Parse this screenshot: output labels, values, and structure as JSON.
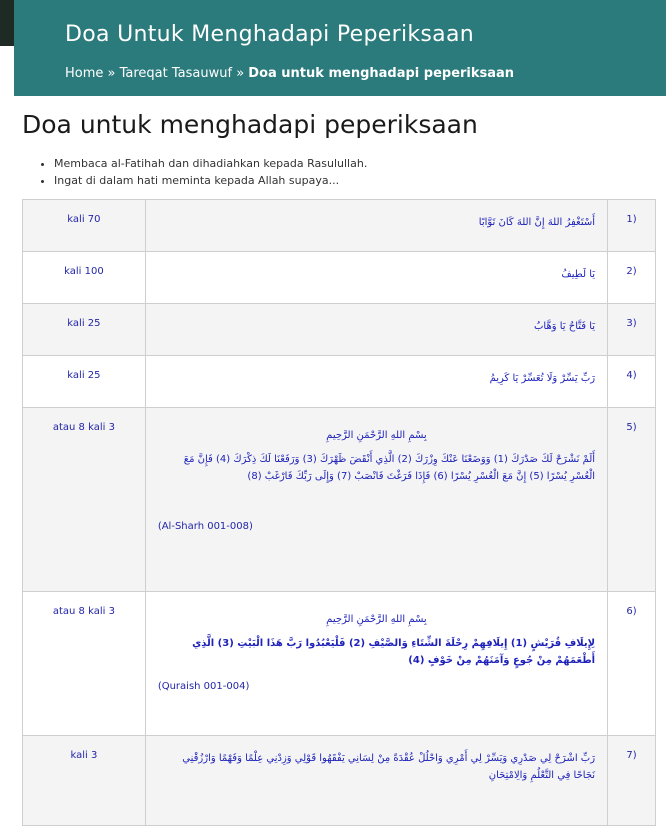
{
  "header": {
    "title": "Doa Untuk Menghadapi Peperiksaan",
    "breadcrumb": {
      "home": "Home",
      "sep1": " » ",
      "category": "Tareqat Tasauwuf",
      "sep2": " » ",
      "current": "Doa untuk menghadapi peperiksaan"
    }
  },
  "page_title": "Doa untuk menghadapi peperiksaan",
  "bullets": [
    "Membaca al-Fatihah dan dihadiahkan kepada Rasulullah.",
    "Ingat di dalam hati meminta kepada Allah supaya..."
  ],
  "rows": [
    {
      "num": "(1",
      "count": "kali 70",
      "text": "أَسْتَغْفِرُ اللهَ إِنَّ اللهَ كَانَ تَوَّابًا"
    },
    {
      "num": "(2",
      "count": "kali 100",
      "text": "يَا لَطِيفُ"
    },
    {
      "num": "(3",
      "count": "kali 25",
      "text": "يَا فَتَّاحُ يَا وَهَّابُ"
    },
    {
      "num": "(4",
      "count": "kali 25",
      "text": "رَبِّ يَسِّرْ وَلَا تُعَسِّرْ يَا كَرِيمُ"
    },
    {
      "num": "(5",
      "count": "atau 8 kali 3",
      "basmala": "بِسْمِ اللهِ الرَّحْمَنِ الرَّحِيمِ",
      "text": "أَلَمْ نَشْرَحْ لَكَ صَدْرَكَ (1) وَوَضَعْنَا عَنْكَ وِزْرَكَ (2) الَّذِي أَنْقَضَ ظَهْرَكَ (3) وَرَفَعْنَا لَكَ ذِكْرَكَ (4) فَإِنَّ مَعَ الْعُسْرِ يُسْرًا (5) إِنَّ مَعَ الْعُسْرِ يُسْرًا (6) فَإِذَا فَرَغْتَ فَانْصَبْ (7) وَإِلَى رَبِّكَ فَارْغَبْ (8)",
      "ref": "(Al-Sharh 001-008)"
    },
    {
      "num": "(6",
      "count": "atau 8 kali 3",
      "basmala": "بِسْمِ اللهِ الرَّحْمَنِ الرَّحِيمِ",
      "text": "لِإِيلَافِ قُرَيْشٍ (1) إِيلَافِهِمْ رِحْلَةَ الشِّتَاءِ وَالصَّيْفِ (2) فَلْيَعْبُدُوا رَبَّ هَذَا الْبَيْتِ (3) الَّذِي أَطْعَمَهُمْ مِنْ جُوعٍ وَآمَنَهُمْ مِنْ خَوْفٍ (4)",
      "ref": "(Quraish 001-004)"
    },
    {
      "num": "(7",
      "count": "kali 3",
      "text": "رَبِّ اشْرَحْ لِي صَدْرِي وَيَسِّرْ لِي أَمْرِي وَاحْلُلْ عُقْدَةً مِنْ لِسَانِي يَفْقَهُوا قَوْلِي وَزِدْنِي عِلْمًا وَفَهْمًا وَارْزُقْنِي نَجَاحًا فِي التَّعْلُمِ وَالِامْتِحَانِ"
    }
  ]
}
